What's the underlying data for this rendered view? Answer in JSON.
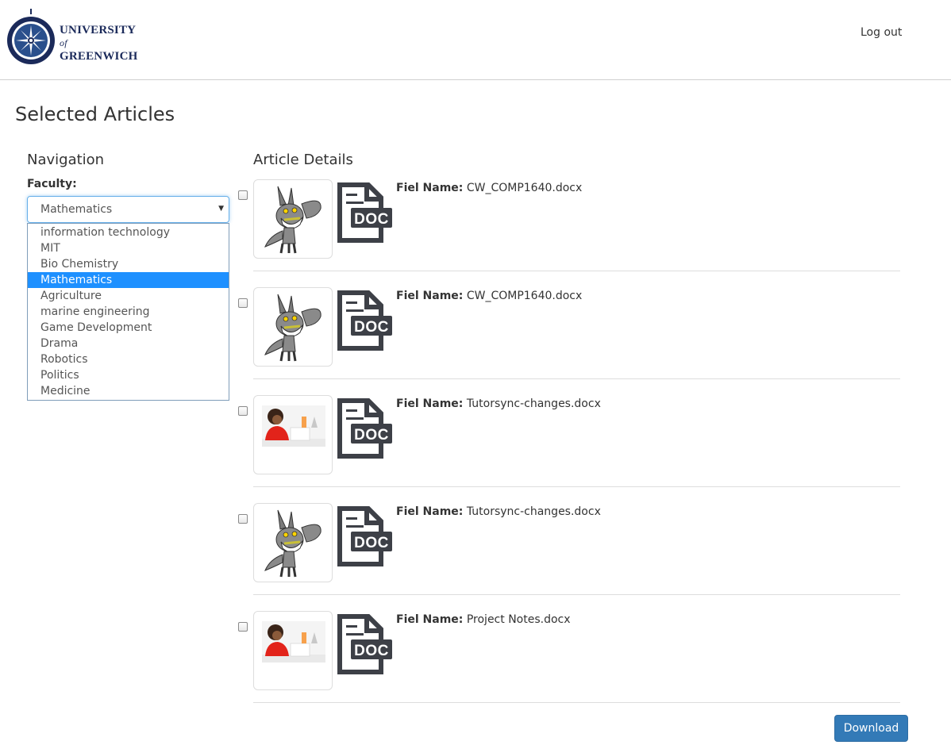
{
  "header": {
    "logo": {
      "line1": "UNIVERSITY",
      "line2": "of",
      "line3": "GREENWICH",
      "seal_text": "UNIVERSITY OF GREENWICH",
      "color": "#1b2a5a"
    },
    "logout_label": "Log out"
  },
  "page_title": "Selected Articles",
  "navigation": {
    "title": "Navigation",
    "faculty_label": "Faculty:",
    "select_value": "Mathematics",
    "options": [
      {
        "label": "information technology",
        "selected": false
      },
      {
        "label": "MIT",
        "selected": false
      },
      {
        "label": "Bio Chemistry",
        "selected": false
      },
      {
        "label": "Mathematics",
        "selected": true
      },
      {
        "label": "Agriculture",
        "selected": false
      },
      {
        "label": "marine engineering",
        "selected": false
      },
      {
        "label": "Game Development",
        "selected": false
      },
      {
        "label": "Drama",
        "selected": false
      },
      {
        "label": "Robotics",
        "selected": false
      },
      {
        "label": "Politics",
        "selected": false
      },
      {
        "label": "Medicine",
        "selected": false
      }
    ],
    "highlight_color": "#1e90ff"
  },
  "article_details": {
    "title": "Article Details",
    "field_label": "Fiel Name:",
    "articles": [
      {
        "file_name": "CW_COMP1640.docx",
        "thumbnail": "wolf-cartoon",
        "file_icon": "doc-file-icon",
        "icon_text": "DOC"
      },
      {
        "file_name": "CW_COMP1640.docx",
        "thumbnail": "wolf-cartoon",
        "file_icon": "doc-file-icon",
        "icon_text": "DOC"
      },
      {
        "file_name": "Tutorsync-changes.docx",
        "thumbnail": "student-photo",
        "file_icon": "doc-file-icon",
        "icon_text": "DOC"
      },
      {
        "file_name": "Tutorsync-changes.docx",
        "thumbnail": "wolf-cartoon",
        "file_icon": "doc-file-icon",
        "icon_text": "DOC"
      },
      {
        "file_name": "Project Notes.docx",
        "thumbnail": "student-photo",
        "file_icon": "doc-file-icon",
        "icon_text": "DOC"
      }
    ]
  },
  "download_label": "Download",
  "colors": {
    "primary": "#337ab7",
    "doc_icon": "#3d4047"
  }
}
